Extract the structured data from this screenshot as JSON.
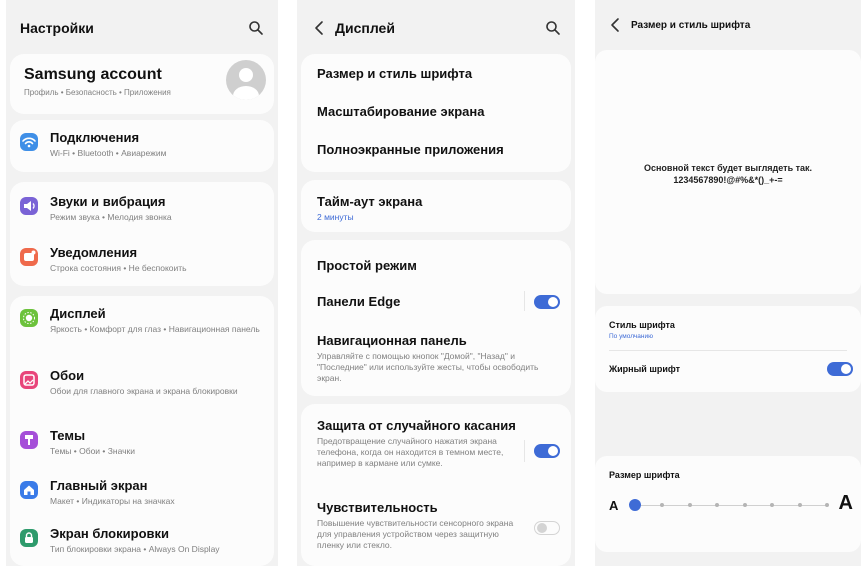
{
  "settings": {
    "title": "Настройки",
    "account": {
      "name": "Samsung account",
      "subtitle": "Профиль • Безопасность • Приложения"
    },
    "items": [
      {
        "icon": "wifi-icon",
        "color": "#3f8fe7",
        "title": "Подключения",
        "subtitle": "Wi-Fi • Bluetooth • Авиарежим"
      },
      {
        "icon": "volume-icon",
        "color": "#7a63d6",
        "title": "Звуки и вибрация",
        "subtitle": "Режим звука • Мелодия звонка"
      },
      {
        "icon": "notification-icon",
        "color": "#ef6a4c",
        "title": "Уведомления",
        "subtitle": "Строка состояния • Не беспокоить"
      },
      {
        "icon": "brightness-icon",
        "color": "#6cc23c",
        "title": "Дисплей",
        "subtitle": "Яркость • Комфорт для глаз • Навигационная панель"
      },
      {
        "icon": "wallpaper-icon",
        "color": "#e8457a",
        "title": "Обои",
        "subtitle": "Обои для главного экрана и экрана блокировки"
      },
      {
        "icon": "themes-icon",
        "color": "#a54fd8",
        "title": "Темы",
        "subtitle": "Темы • Обои • Значки"
      },
      {
        "icon": "home-icon",
        "color": "#3a7be8",
        "title": "Главный экран",
        "subtitle": "Макет • Индикаторы на значках"
      },
      {
        "icon": "lock-icon",
        "color": "#2e9b6c",
        "title": "Экран блокировки",
        "subtitle": "Тип блокировки экрана • Always On Display"
      }
    ]
  },
  "display": {
    "title": "Дисплей",
    "font_size_style": "Размер и стиль шрифта",
    "screen_zoom": "Масштабирование экрана",
    "fullscreen_apps": "Полноэкранные приложения",
    "screen_timeout": {
      "title": "Тайм-аут экрана",
      "value": "2 минуты"
    },
    "easy_mode": "Простой режим",
    "edge_panels": {
      "title": "Панели Edge",
      "on": true
    },
    "navigation_bar": {
      "title": "Навигационная панель",
      "subtitle": "Управляйте с помощью кнопок \"Домой\", \"Назад\" и \"Последние\" или используйте жесты, чтобы освободить экран."
    },
    "accidental_touch": {
      "title": "Защита от случайного касания",
      "subtitle": "Предотвращение случайного нажатия экрана телефона, когда он находится в темном месте, например в кармане или сумке.",
      "on": true
    },
    "touch_sensitivity": {
      "title": "Чувствительность",
      "subtitle": "Повышение чувствительности сенсорного экрана для управления устройством через защитную пленку или стекло.",
      "on": false
    }
  },
  "font": {
    "title": "Размер и стиль шрифта",
    "preview_line1": "Основной текст будет выглядеть так.",
    "preview_line2": "1234567890!@#%&*()_+-=",
    "style": {
      "title": "Стиль шрифта",
      "value": "По умолчанию"
    },
    "bold": {
      "title": "Жирный шрифт",
      "on": true
    },
    "size": {
      "title": "Размер шрифта",
      "small_label": "A",
      "large_label": "A",
      "level": 0,
      "steps": 8
    }
  },
  "colors": {
    "accent": "#3e6bd6",
    "background": "#f2f2f2",
    "card": "#fcfcfc"
  }
}
